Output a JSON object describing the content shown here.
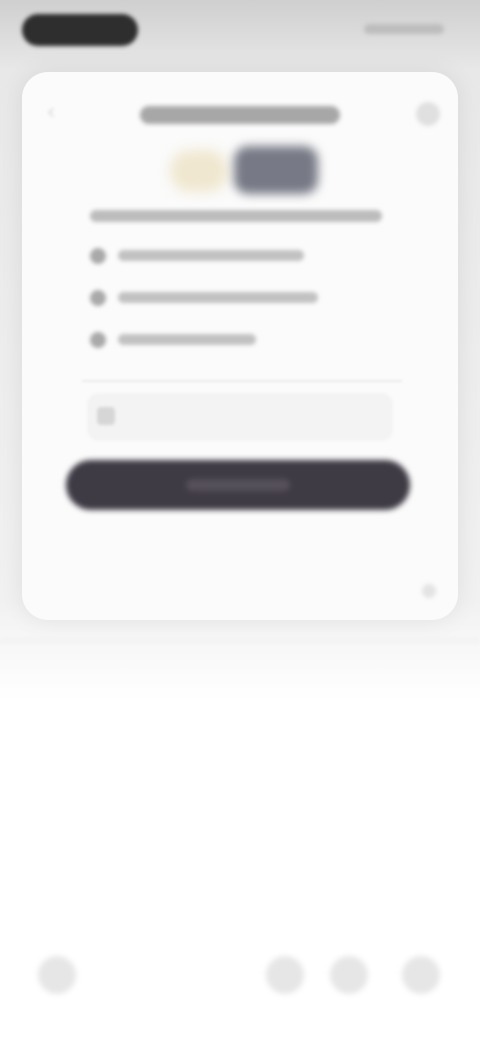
{
  "status_bar": {
    "left_indicator": "pill",
    "right_icons": [
      "signal-icon",
      "wifi-icon",
      "battery-icon"
    ]
  },
  "dialog": {
    "title": "",
    "intro": "",
    "features": [
      {
        "icon": "check-icon",
        "text": ""
      },
      {
        "icon": "check-icon",
        "text": ""
      },
      {
        "icon": "check-icon",
        "text": ""
      }
    ],
    "input": {
      "value": "",
      "placeholder": ""
    },
    "primary_button_label": "",
    "back_icon": "chevron-left-icon",
    "close_icon": "close-icon"
  },
  "bottom_nav": {
    "items": [
      {
        "icon": "back-icon"
      },
      {
        "icon": "home-icon"
      },
      {
        "icon": "tabs-icon"
      },
      {
        "icon": "menu-icon"
      }
    ]
  },
  "colors": {
    "button_dark": "#3f3b45",
    "illustration_dark": "#777a86",
    "illustration_light": "#efe7cf",
    "card_bg": "#fbfbfb",
    "backdrop": "#e8e8e8"
  }
}
